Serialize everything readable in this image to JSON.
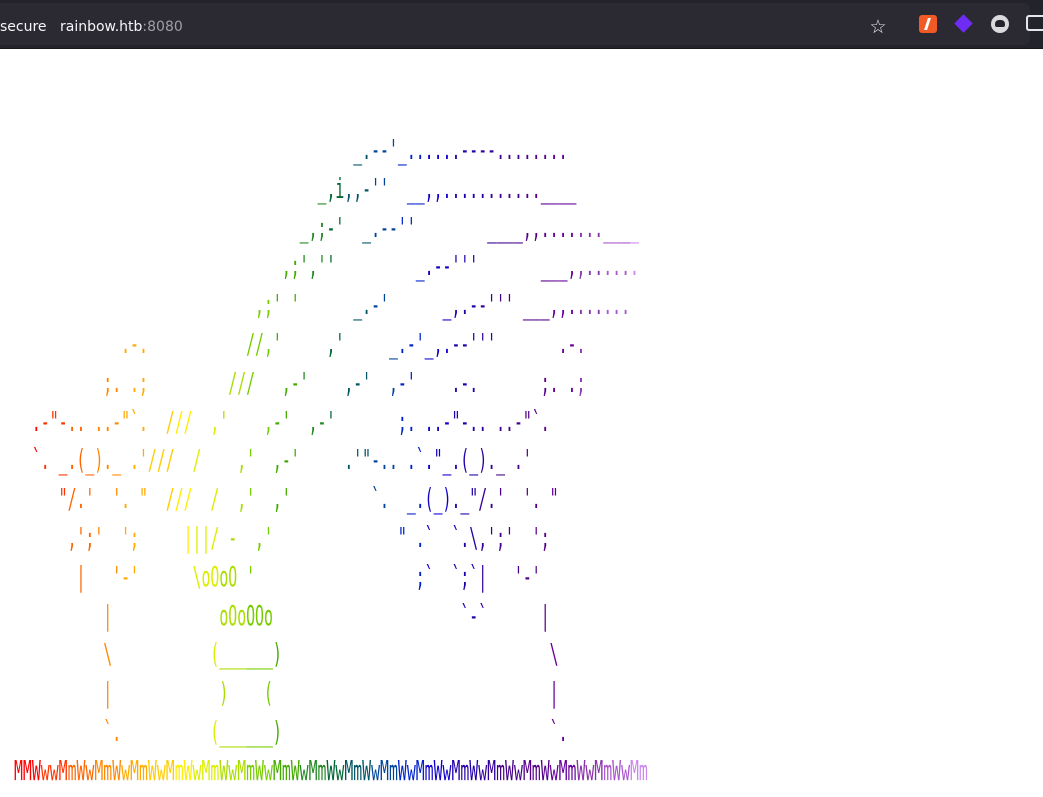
{
  "browser": {
    "security_label": "secure",
    "url_host": "rainbow.htb",
    "url_port": ":8080",
    "icons": [
      "star-icon",
      "bolt-extension-icon",
      "cube-extension-icon",
      "mask-extension-icon",
      "puzzle-extension-icon"
    ]
  },
  "art": {
    "columns": 71,
    "palette": [
      "#ff0000",
      "#ff3300",
      "#ff6600",
      "#ff8800",
      "#ffaa00",
      "#ffcc00",
      "#ffee00",
      "#ddee00",
      "#aadd00",
      "#77cc00",
      "#44aa00",
      "#228822",
      "#006633",
      "#005566",
      "#004499",
      "#0022cc",
      "#1100cc",
      "#2200aa",
      "#330099",
      "#440088",
      "#550088",
      "#660099",
      "#8833aa",
      "#aa55cc",
      "#cc88ee"
    ],
    "lines": [
      "                                      _.--'_......----........",
      "                                  _,i,,-''  __,,...........____",
      "                                _,;-'  _.--''        ____,,.......____",
      "                              ,;',''         _.--'''       ___,,......",
      "                           ,;' '      _.-'      _,.--''' ___,,.......",
      "            .-.           //,'     ,'     _.-'_,.--'''       .-.",
      "          ;. .;         ///   ,-'    ,-'  ,-'    .-.       ;. .;",
      "  .-\"-.. ..-\"`.  ///  ,'    ,-'  ,-'       ;. ..-\"-.. ..-\"`.",
      "  `. _.(_)._ .'///  /    ,'  ,-'     .'\"-.. .`.\"_.(_)._ .'",
      "     \"/.'  '. \"  ///  /  ,'  ,'         `.  _.(_)._\"/.'  '. \"",
      "      ,';'  ';     |||/ -  ,'              \" .`  `.\\,';'  ';",
      "       |   '-'      \\oOoO '                  ;`  `;`|   '-'",
      "          |            oOoOOo                     `-`      |",
      "          \\           (______)                              \\",
      "          |            )    (                               |",
      "          `.          (______)                              `.",
      "MMWwwMmWwMmWwMmWwMmWwMmWwMmWwMmWwMmWwMmWwMmWwMmWwMmWwMmWwMmWwMmWwMmWwMm"
    ]
  }
}
